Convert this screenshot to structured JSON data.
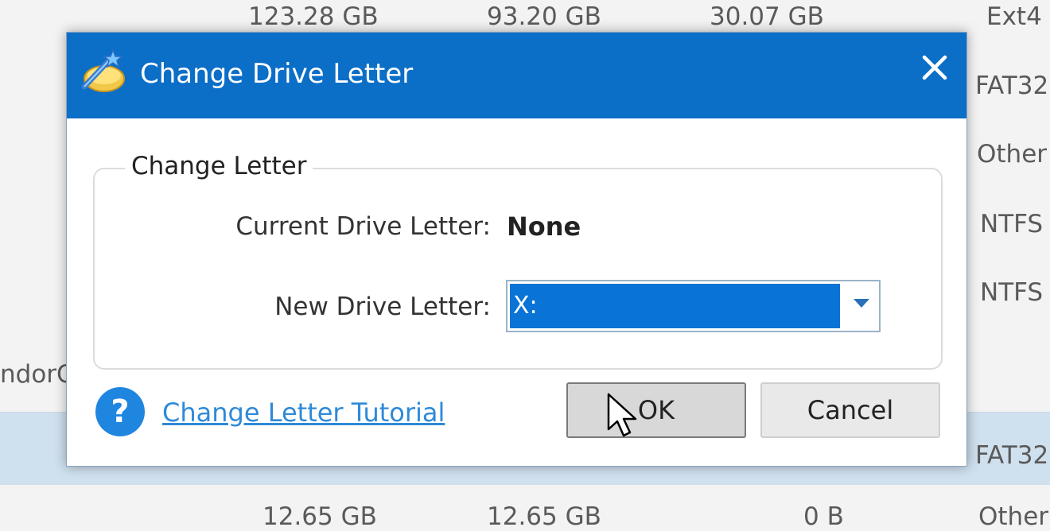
{
  "background": {
    "row_top": [
      "123.28 GB",
      "93.20 GB",
      "30.07 GB",
      "Ext4"
    ],
    "fs_column": [
      "FAT32",
      "Other",
      "NTFS",
      "NTFS"
    ],
    "left_fragment": "ndorC",
    "selected_row_fs": "FAT32",
    "row_bottom": [
      "12.65 GB",
      "12.65 GB",
      "0 B",
      "Other"
    ]
  },
  "dialog": {
    "title": "Change Drive Letter",
    "title_icon": "drive-letter-wand-icon",
    "close_icon": "close-icon",
    "group_label": "Change Letter",
    "current_label": "Current Drive Letter:",
    "current_value": "None",
    "new_label": "New Drive Letter:",
    "new_value": "X:",
    "help_icon_glyph": "?",
    "help_link": "Change Letter Tutorial",
    "ok_label": "OK",
    "cancel_label": "Cancel"
  },
  "colors": {
    "titlebar": "#0b6ec7",
    "selection": "#0a73d6",
    "link": "#2f8ad8"
  }
}
